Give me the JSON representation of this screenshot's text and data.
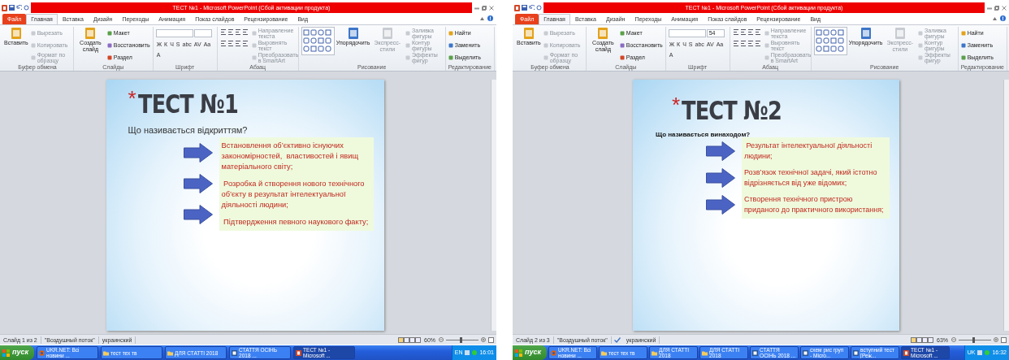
{
  "screens": [
    {
      "window": {
        "title": "ТЕСТ №1  -  Microsoft PowerPoint (Сбой активации продукта)"
      },
      "tabs": [
        {
          "label": "Файл",
          "kind": "file",
          "selected": false
        },
        {
          "label": "Главная",
          "kind": "tab",
          "selected": true
        },
        {
          "label": "Вставка",
          "kind": "tab",
          "selected": false
        },
        {
          "label": "Дизайн",
          "kind": "tab",
          "selected": false
        },
        {
          "label": "Переходы",
          "kind": "tab",
          "selected": false
        },
        {
          "label": "Анимация",
          "kind": "tab",
          "selected": false
        },
        {
          "label": "Показ слайдов",
          "kind": "tab",
          "selected": false
        },
        {
          "label": "Рецензирование",
          "kind": "tab",
          "selected": false
        },
        {
          "label": "Вид",
          "kind": "tab",
          "selected": false
        }
      ],
      "ribbon": {
        "groups": [
          {
            "label": "Буфер обмена",
            "kind": "grid",
            "items": [
              {
                "kind": "large",
                "label": "Вставить",
                "disabled": false
              },
              {
                "kind": "small",
                "label": "Вырезать",
                "disabled": true
              },
              {
                "kind": "small",
                "label": "Копировать",
                "disabled": true
              },
              {
                "kind": "small",
                "label": "Формат по образцу",
                "disabled": true
              }
            ]
          },
          {
            "label": "Слайды",
            "kind": "grid",
            "items": [
              {
                "kind": "large",
                "label": "Создать слайд",
                "disabled": false
              },
              {
                "kind": "small",
                "label": "Макет",
                "disabled": false
              },
              {
                "kind": "small",
                "label": "Восстановить",
                "disabled": false
              },
              {
                "kind": "small",
                "label": "Раздел",
                "disabled": false
              }
            ]
          },
          {
            "label": "Шрифт",
            "kind": "wrap",
            "items": [
              {
                "kind": "field"
              },
              {
                "kind": "field"
              },
              {
                "kind": "glyph",
                "label": "Ж"
              },
              {
                "kind": "glyph",
                "label": "К"
              },
              {
                "kind": "glyph",
                "label": "Ч"
              },
              {
                "kind": "glyph",
                "label": "S"
              },
              {
                "kind": "glyph",
                "label": "abc"
              },
              {
                "kind": "glyph",
                "label": "AV"
              },
              {
                "kind": "glyph",
                "label": "Aa"
              },
              {
                "kind": "glyph",
                "label": "A"
              }
            ]
          },
          {
            "label": "Абзац",
            "kind": "grid",
            "items": [
              {
                "kind": "icons"
              },
              {
                "kind": "small",
                "label": "Направление текста",
                "disabled": true
              },
              {
                "kind": "small",
                "label": "Выровнять текст",
                "disabled": true
              },
              {
                "kind": "small",
                "label": "Преобразовать в SmartArt",
                "disabled": true
              }
            ]
          },
          {
            "label": "Рисование",
            "kind": "grid",
            "items": [
              {
                "kind": "gallery"
              },
              {
                "kind": "large",
                "label": "Упорядочить",
                "disabled": false
              },
              {
                "kind": "large",
                "label": "Экспресс-стили",
                "disabled": true
              },
              {
                "kind": "small",
                "label": "Заливка фигуры",
                "disabled": true
              },
              {
                "kind": "small",
                "label": "Контур фигуры",
                "disabled": true
              },
              {
                "kind": "small",
                "label": "Эффекты фигур",
                "disabled": true
              }
            ]
          },
          {
            "label": "Редактирование",
            "kind": "grid",
            "items": [
              {
                "kind": "small",
                "label": "Найти",
                "disabled": false
              },
              {
                "kind": "small",
                "label": "Заменить",
                "disabled": false
              },
              {
                "kind": "small",
                "label": "Выделить",
                "disabled": false
              }
            ]
          }
        ]
      },
      "slide": {
        "title_mark": "*",
        "title": "ТЕСТ №1",
        "question": "Що називається відкриттям?",
        "answers": [
          "Встановлення об’єктивно існуючих закономірностей,  властивостей і явищ матеріального світу;",
          " Розробка й створення нового технічного об’єкту в результат інтелектуальної діяльності людини;",
          " Підтвердження певного наукового факту;"
        ]
      },
      "status_bar": {
        "slide_info": "Слайд 1 из 2",
        "theme": "\"Воздушный поток\"",
        "proofing_icon": false,
        "language": "украинский",
        "zoom": "60%",
        "zoom_slider": {
          "level": 0.45
        }
      },
      "taskbar": {
        "start": "пуск",
        "items": [
          {
            "label": "UKR.NET: Всі новини ...",
            "kind": "browser",
            "selected": false
          },
          {
            "label": "тест тех тв",
            "kind": "folder",
            "selected": false
          },
          {
            "label": "ДЛЯ СТАТТІ 2018",
            "kind": "folder",
            "selected": false
          },
          {
            "label": "СТАТТЯ ОСІНЬ 2018 ...",
            "kind": "word",
            "selected": false
          },
          {
            "label": "ТЕСТ №1 - Microsoft ...",
            "kind": "powerpoint",
            "selected": true
          }
        ],
        "language": "EN",
        "clock": "16:01"
      }
    },
    {
      "window": {
        "title": "ТЕСТ №1  -  Microsoft PowerPoint (Сбой активации продукта)"
      },
      "tabs": [
        {
          "label": "Файл",
          "kind": "file",
          "selected": false
        },
        {
          "label": "Главная",
          "kind": "tab",
          "selected": true
        },
        {
          "label": "Вставка",
          "kind": "tab",
          "selected": false
        },
        {
          "label": "Дизайн",
          "kind": "tab",
          "selected": false
        },
        {
          "label": "Переходы",
          "kind": "tab",
          "selected": false
        },
        {
          "label": "Анимация",
          "kind": "tab",
          "selected": false
        },
        {
          "label": "Показ слайдов",
          "kind": "tab",
          "selected": false
        },
        {
          "label": "Рецензирование",
          "kind": "tab",
          "selected": false
        },
        {
          "label": "Вид",
          "kind": "tab",
          "selected": false
        }
      ],
      "ribbon": {
        "groups": [
          {
            "label": "Буфер обмена",
            "kind": "grid",
            "items": [
              {
                "kind": "large",
                "label": "Вставить",
                "disabled": false
              },
              {
                "kind": "small",
                "label": "Вырезать",
                "disabled": true
              },
              {
                "kind": "small",
                "label": "Копировать",
                "disabled": true
              },
              {
                "kind": "small",
                "label": "Формат по образцу",
                "disabled": true
              }
            ]
          },
          {
            "label": "Слайды",
            "kind": "grid",
            "items": [
              {
                "kind": "large",
                "label": "Создать слайд",
                "disabled": false
              },
              {
                "kind": "small",
                "label": "Макет",
                "disabled": false
              },
              {
                "kind": "small",
                "label": "Восстановить",
                "disabled": false
              },
              {
                "kind": "small",
                "label": "Раздел",
                "disabled": false
              }
            ]
          },
          {
            "label": "Шрифт",
            "kind": "wrap",
            "items": [
              {
                "kind": "field"
              },
              {
                "kind": "field",
                "value": "54"
              },
              {
                "kind": "glyph",
                "label": "Ж"
              },
              {
                "kind": "glyph",
                "label": "К"
              },
              {
                "kind": "glyph",
                "label": "Ч"
              },
              {
                "kind": "glyph",
                "label": "S"
              },
              {
                "kind": "glyph",
                "label": "abc"
              },
              {
                "kind": "glyph",
                "label": "AV"
              },
              {
                "kind": "glyph",
                "label": "Aa"
              },
              {
                "kind": "glyph",
                "label": "A"
              }
            ]
          },
          {
            "label": "Абзац",
            "kind": "grid",
            "items": [
              {
                "kind": "icons"
              },
              {
                "kind": "small",
                "label": "Направление текста",
                "disabled": true
              },
              {
                "kind": "small",
                "label": "Выровнять текст",
                "disabled": true
              },
              {
                "kind": "small",
                "label": "Преобразовать в SmartArt",
                "disabled": true
              }
            ]
          },
          {
            "label": "Рисование",
            "kind": "grid",
            "items": [
              {
                "kind": "gallery"
              },
              {
                "kind": "large",
                "label": "Упорядочить",
                "disabled": false
              },
              {
                "kind": "large",
                "label": "Экспресс-стили",
                "disabled": true
              },
              {
                "kind": "small",
                "label": "Заливка фигуры",
                "disabled": true
              },
              {
                "kind": "small",
                "label": "Контур фигуры",
                "disabled": true
              },
              {
                "kind": "small",
                "label": "Эффекты фигур",
                "disabled": true
              }
            ]
          },
          {
            "label": "Редактирование",
            "kind": "grid",
            "items": [
              {
                "kind": "small",
                "label": "Найти",
                "disabled": false
              },
              {
                "kind": "small",
                "label": "Заменить",
                "disabled": false
              },
              {
                "kind": "small",
                "label": "Выделить",
                "disabled": false
              }
            ]
          }
        ]
      },
      "slide": {
        "title_mark": "*",
        "title": "ТЕСТ №2",
        "question": "Що називається винаходом?",
        "answers": [
          " Результат інтелектуальної діяльності людини;",
          "Розв’язок технічної задачі, який істотно відрізняється від уже відомих;",
          "Створення технічного пристрою приданого до практичного використання;"
        ]
      },
      "status_bar": {
        "slide_info": "Слайд 2 из 3",
        "theme": "\"Воздушный поток\"",
        "proofing_icon": true,
        "language": "украинский",
        "zoom": "63%",
        "zoom_slider": {
          "level": 0.45
        }
      },
      "taskbar": {
        "start": "пуск",
        "items": [
          {
            "label": "UKR.NET: Всі новини ...",
            "kind": "browser",
            "selected": false
          },
          {
            "label": "тест тех тв",
            "kind": "folder",
            "selected": false
          },
          {
            "label": "ДЛЯ СТАТТІ 2018",
            "kind": "folder",
            "selected": false
          },
          {
            "label": "ДЛЯ СТАТТІ 2018",
            "kind": "folder",
            "selected": false
          },
          {
            "label": "СТАТТЯ ОСІНЬ 2018 ...",
            "kind": "word",
            "selected": false
          },
          {
            "label": "схем рис груп - Micro...",
            "kind": "word",
            "selected": false
          },
          {
            "label": "вступний тест [Реж...",
            "kind": "word",
            "selected": false
          },
          {
            "label": "ТЕСТ №1 - Microsoft ...",
            "kind": "powerpoint",
            "selected": true
          }
        ],
        "language": "UK",
        "clock": "16:32"
      }
    }
  ]
}
